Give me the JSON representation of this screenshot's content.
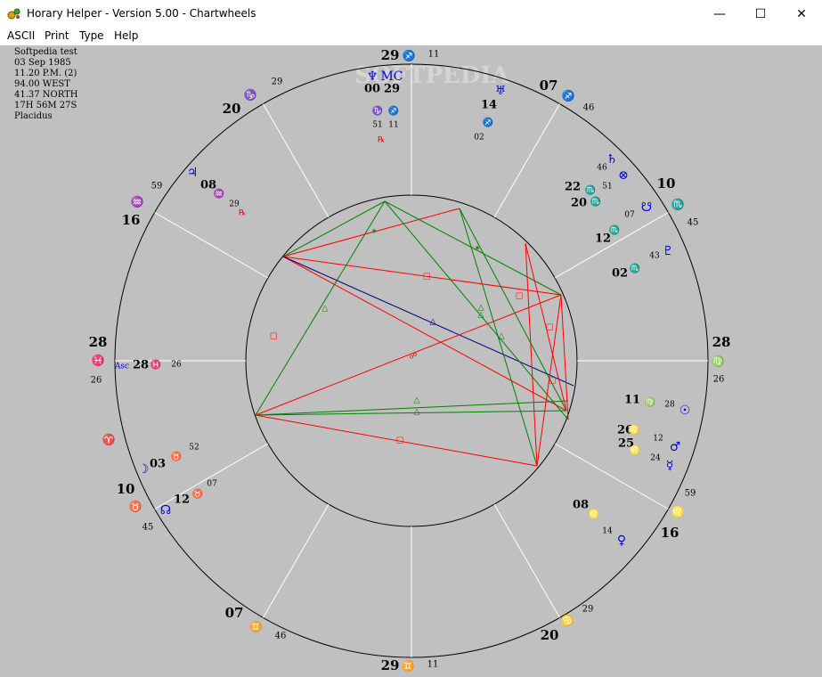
{
  "window": {
    "title": "Horary Helper - Version 5.00 - Chartwheels",
    "controls": {
      "minimize": "—",
      "maximize": "☐",
      "close": "✕"
    }
  },
  "menu": {
    "items": [
      "ASCII",
      "Print",
      "Type",
      "Help"
    ]
  },
  "watermark": "SOFTPEDIA",
  "chart_info": {
    "name": "Softpedia test",
    "date": "03 Sep 1985",
    "time": "11.20 P.M. (2)",
    "longitude": "94.00 WEST",
    "latitude": "41.37 NORTH",
    "sidereal": "17H 56M 27S",
    "house_system": "Placidus"
  },
  "colors": {
    "background": "#c0c0c0",
    "ring": "#000000",
    "house_lines": "#ffffff",
    "fire_red": "#e00000",
    "planet_blue": "#0000e0",
    "aspect_red": "#ff0000",
    "aspect_green": "#008000",
    "aspect_blue": "#000080"
  },
  "cusps": [
    {
      "house": "1",
      "deg": "28",
      "min": "26",
      "sign": "♓"
    },
    {
      "house": "2",
      "deg": "10",
      "min": "45",
      "sign": "♉"
    },
    {
      "house": "3",
      "deg": "07",
      "min": "46",
      "sign": "♊"
    },
    {
      "house": "4",
      "deg": "29",
      "min": "11",
      "sign": "♊"
    },
    {
      "house": "5",
      "deg": "20",
      "min": "29",
      "sign": "♋"
    },
    {
      "house": "6",
      "deg": "16",
      "min": "59",
      "sign": "♌"
    },
    {
      "house": "7",
      "deg": "28",
      "min": "26",
      "sign": "♍"
    },
    {
      "house": "8",
      "deg": "10",
      "min": "45",
      "sign": "♏"
    },
    {
      "house": "9",
      "deg": "07",
      "min": "46",
      "sign": "♐"
    },
    {
      "house": "10",
      "deg": "29",
      "min": "11",
      "sign": "♐"
    },
    {
      "house": "11",
      "deg": "20",
      "min": "29",
      "sign": "♑"
    },
    {
      "house": "12",
      "deg": "16",
      "min": "59",
      "sign": "♒"
    }
  ],
  "aries_glyph": "♈",
  "planets": [
    {
      "name": "Ascendant",
      "glyph": "Asc",
      "deg": "28",
      "sign": "♓",
      "min": "26"
    },
    {
      "name": "Moon",
      "glyph": "☽",
      "deg": "03",
      "sign": "♉",
      "min": "52"
    },
    {
      "name": "Node",
      "glyph": "☊",
      "deg": "12",
      "sign": "♉",
      "min": "07"
    },
    {
      "name": "Venus",
      "glyph": "♀",
      "deg": "08",
      "sign": "♌",
      "min": "14"
    },
    {
      "name": "Mercury",
      "glyph": "☿",
      "deg": "25",
      "sign": "♌",
      "min": "24"
    },
    {
      "name": "Mars",
      "glyph": "♂",
      "deg": "26",
      "sign": "♌",
      "min": "12"
    },
    {
      "name": "Sun",
      "glyph": "☉",
      "deg": "11",
      "sign": "♍",
      "min": "28"
    },
    {
      "name": "Pluto",
      "glyph": "♇",
      "deg": "02",
      "sign": "♏",
      "min": "43"
    },
    {
      "name": "Fortune",
      "glyph": "☋",
      "deg": "12",
      "sign": "♏",
      "min": "07"
    },
    {
      "name": "Part of Fortune",
      "glyph": "⊗",
      "deg": "20",
      "sign": "♏",
      "min": "51"
    },
    {
      "name": "Saturn",
      "glyph": "♄",
      "deg": "22",
      "sign": "♏",
      "min": "46"
    },
    {
      "name": "Uranus",
      "glyph": "♅",
      "deg": "14",
      "sign": "♐",
      "min": "02"
    },
    {
      "name": "Neptune",
      "glyph": "♆",
      "deg": "00",
      "sign": "♑",
      "min": "51"
    },
    {
      "name": "Midheaven",
      "glyph": "MC",
      "deg": "29",
      "sign": "♐",
      "min": "11"
    },
    {
      "name": "Jupiter",
      "glyph": "♃",
      "deg": "08",
      "sign": "♒",
      "min": "29"
    }
  ],
  "retrograde": "℞",
  "aspect_marks": {
    "square": "□",
    "trine": "△",
    "opposition": "☍",
    "sextile": "✶"
  }
}
